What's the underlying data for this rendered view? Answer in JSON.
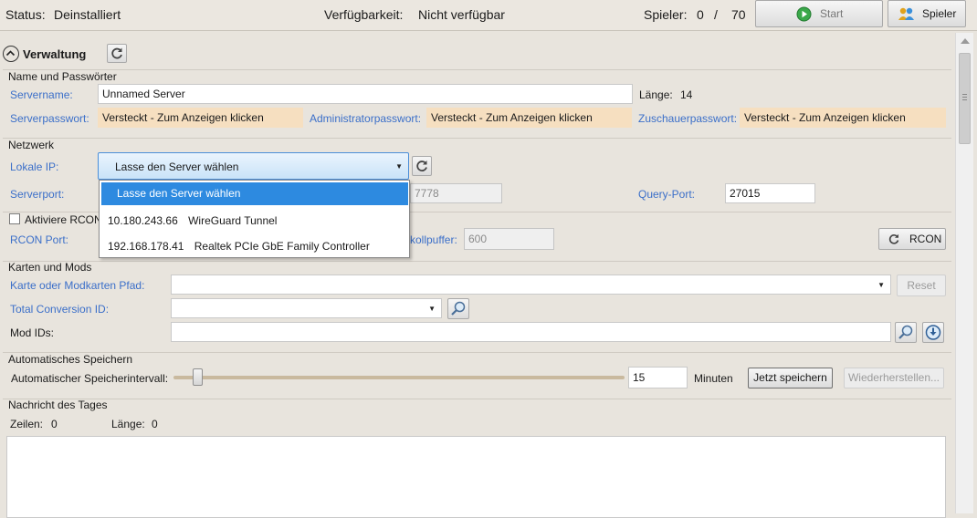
{
  "statusbar": {
    "status_label": "Status:",
    "status_value": "Deinstalliert",
    "availability_label": "Verfügbarkeit:",
    "availability_value": "Nicht verfügbar",
    "players_label": "Spieler:",
    "players_current": "0",
    "players_sep": "/",
    "players_max": "70",
    "start_label": "Start",
    "players_button_label": "Spieler"
  },
  "administration": {
    "title": "Verwaltung",
    "name_group": {
      "title": "Name und Passwörter",
      "servername_label": "Servername:",
      "servername_value": "Unnamed Server",
      "length_label": "Länge:",
      "length_value": "14",
      "server_pw_label": "Serverpasswort:",
      "server_pw_value": "Versteckt - Zum Anzeigen klicken",
      "admin_pw_label": "Administratorpasswort:",
      "admin_pw_value": "Versteckt - Zum Anzeigen klicken",
      "spectator_pw_label": "Zuschauerpasswort:",
      "spectator_pw_value": "Versteckt - Zum Anzeigen klicken"
    },
    "network_group": {
      "title": "Netzwerk",
      "local_ip_label": "Lokale IP:",
      "local_ip_selected": "Lasse den Server wählen",
      "serverport_label": "Serverport:",
      "peer_port_value": "7778",
      "query_port_label": "Query-Port:",
      "query_port_value": "27015",
      "dropdown_options": [
        {
          "ip": "",
          "name": "Lasse den Server wählen"
        },
        {
          "ip": "10.180.243.66",
          "name": "WireGuard Tunnel"
        },
        {
          "ip": "192.168.178.41",
          "name": "Realtek PCIe GbE Family Controller"
        }
      ]
    },
    "rcon_group": {
      "enable_label": "Aktiviere RCON",
      "rcon_port_label": "RCON Port:",
      "buffer_label_visible": "kollpuffer:",
      "buffer_value": "600",
      "rcon_button_label": "RCON"
    },
    "maps_group": {
      "title": "Karten und Mods",
      "map_path_label": "Karte oder Modkarten Pfad:",
      "map_path_value": "",
      "reset_label": "Reset",
      "tc_id_label": "Total Conversion ID:",
      "tc_id_value": "",
      "mod_ids_label": "Mod IDs:",
      "mod_ids_value": ""
    },
    "autosave_group": {
      "title": "Automatisches Speichern",
      "interval_label": "Automatischer Speicherintervall:",
      "interval_value": "15",
      "interval_fraction": 0.03,
      "unit_label": "Minuten",
      "save_now_label": "Jetzt speichern",
      "restore_label": "Wiederherstellen..."
    },
    "motd_group": {
      "title": "Nachricht des Tages",
      "lines_label": "Zeilen:",
      "lines_value": "0",
      "length_label": "Länge:",
      "length_value": "0",
      "text": ""
    }
  },
  "colors": {
    "accent_blue": "#3b6fc9",
    "selection_blue": "#2d8ae0",
    "password_bg": "#f6dfc0",
    "background": "#e8e4dd"
  }
}
